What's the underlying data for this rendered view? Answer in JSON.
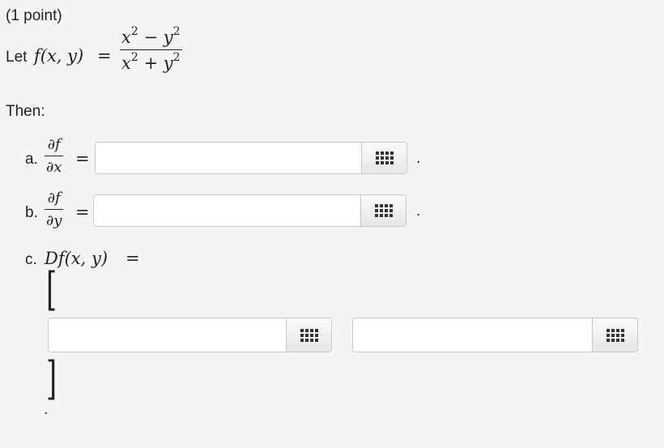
{
  "header": {
    "points": "(1 point)"
  },
  "problem": {
    "let_label": "Let",
    "function_lhs": "f(x, y)",
    "equals": "=",
    "numerator": "x² − y²",
    "denominator": "x² + y²"
  },
  "then_label": "Then:",
  "parts": {
    "a": {
      "label": "a.",
      "num": "∂f",
      "den": "∂x",
      "equals": "=",
      "value": "",
      "period": "."
    },
    "b": {
      "label": "b.",
      "num": "∂f",
      "den": "∂y",
      "equals": "=",
      "value": "",
      "period": "."
    },
    "c": {
      "label": "c.",
      "lhs": "Df(x, y)",
      "equals": "=",
      "open_bracket": "[",
      "close_bracket": "]",
      "value_1": "",
      "value_2": "",
      "period": "."
    }
  },
  "icons": {
    "equation_editor": "grid-icon"
  }
}
